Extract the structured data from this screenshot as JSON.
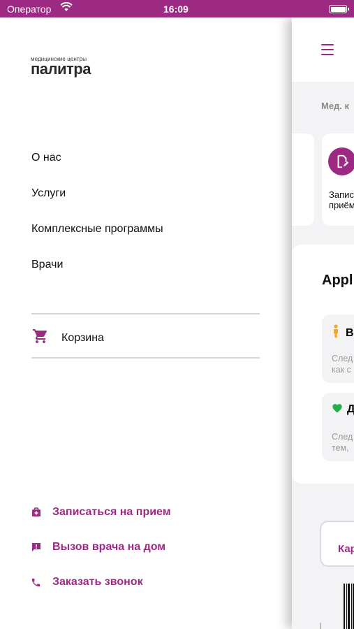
{
  "status_bar": {
    "carrier": "Оператор",
    "time": "16:09"
  },
  "drawer": {
    "logo": {
      "subtitle": "медицинские центры",
      "name": "палитра"
    },
    "menu": [
      {
        "label": "О нас"
      },
      {
        "label": "Услуги"
      },
      {
        "label": "Комплексные программы"
      },
      {
        "label": "Врачи"
      }
    ],
    "cart": {
      "label": "Корзина",
      "icon": "cart-icon"
    },
    "actions": [
      {
        "label": "Записаться на прием",
        "icon": "medical-bag-icon"
      },
      {
        "label": "Вызов врача на дом",
        "icon": "chat-alert-icon"
      },
      {
        "label": "Заказать звонок",
        "icon": "phone-icon"
      }
    ]
  },
  "main": {
    "med_label": "Мед. к",
    "appointment_card": {
      "line1": "Запис",
      "line2": "приём"
    },
    "panel": {
      "title": "Appl",
      "items": [
        {
          "head": "В",
          "desc1": "След",
          "desc2": "как с",
          "icon": "person-icon"
        },
        {
          "head": "Д",
          "desc1": "След",
          "desc2": "тем,",
          "icon": "heart-icon"
        }
      ]
    },
    "bottom_card": {
      "label": "Кар"
    }
  },
  "colors": {
    "accent": "#9c2a83",
    "status_bar": "#9c2a83",
    "text": "#111111",
    "muted": "#9a9a9a"
  }
}
